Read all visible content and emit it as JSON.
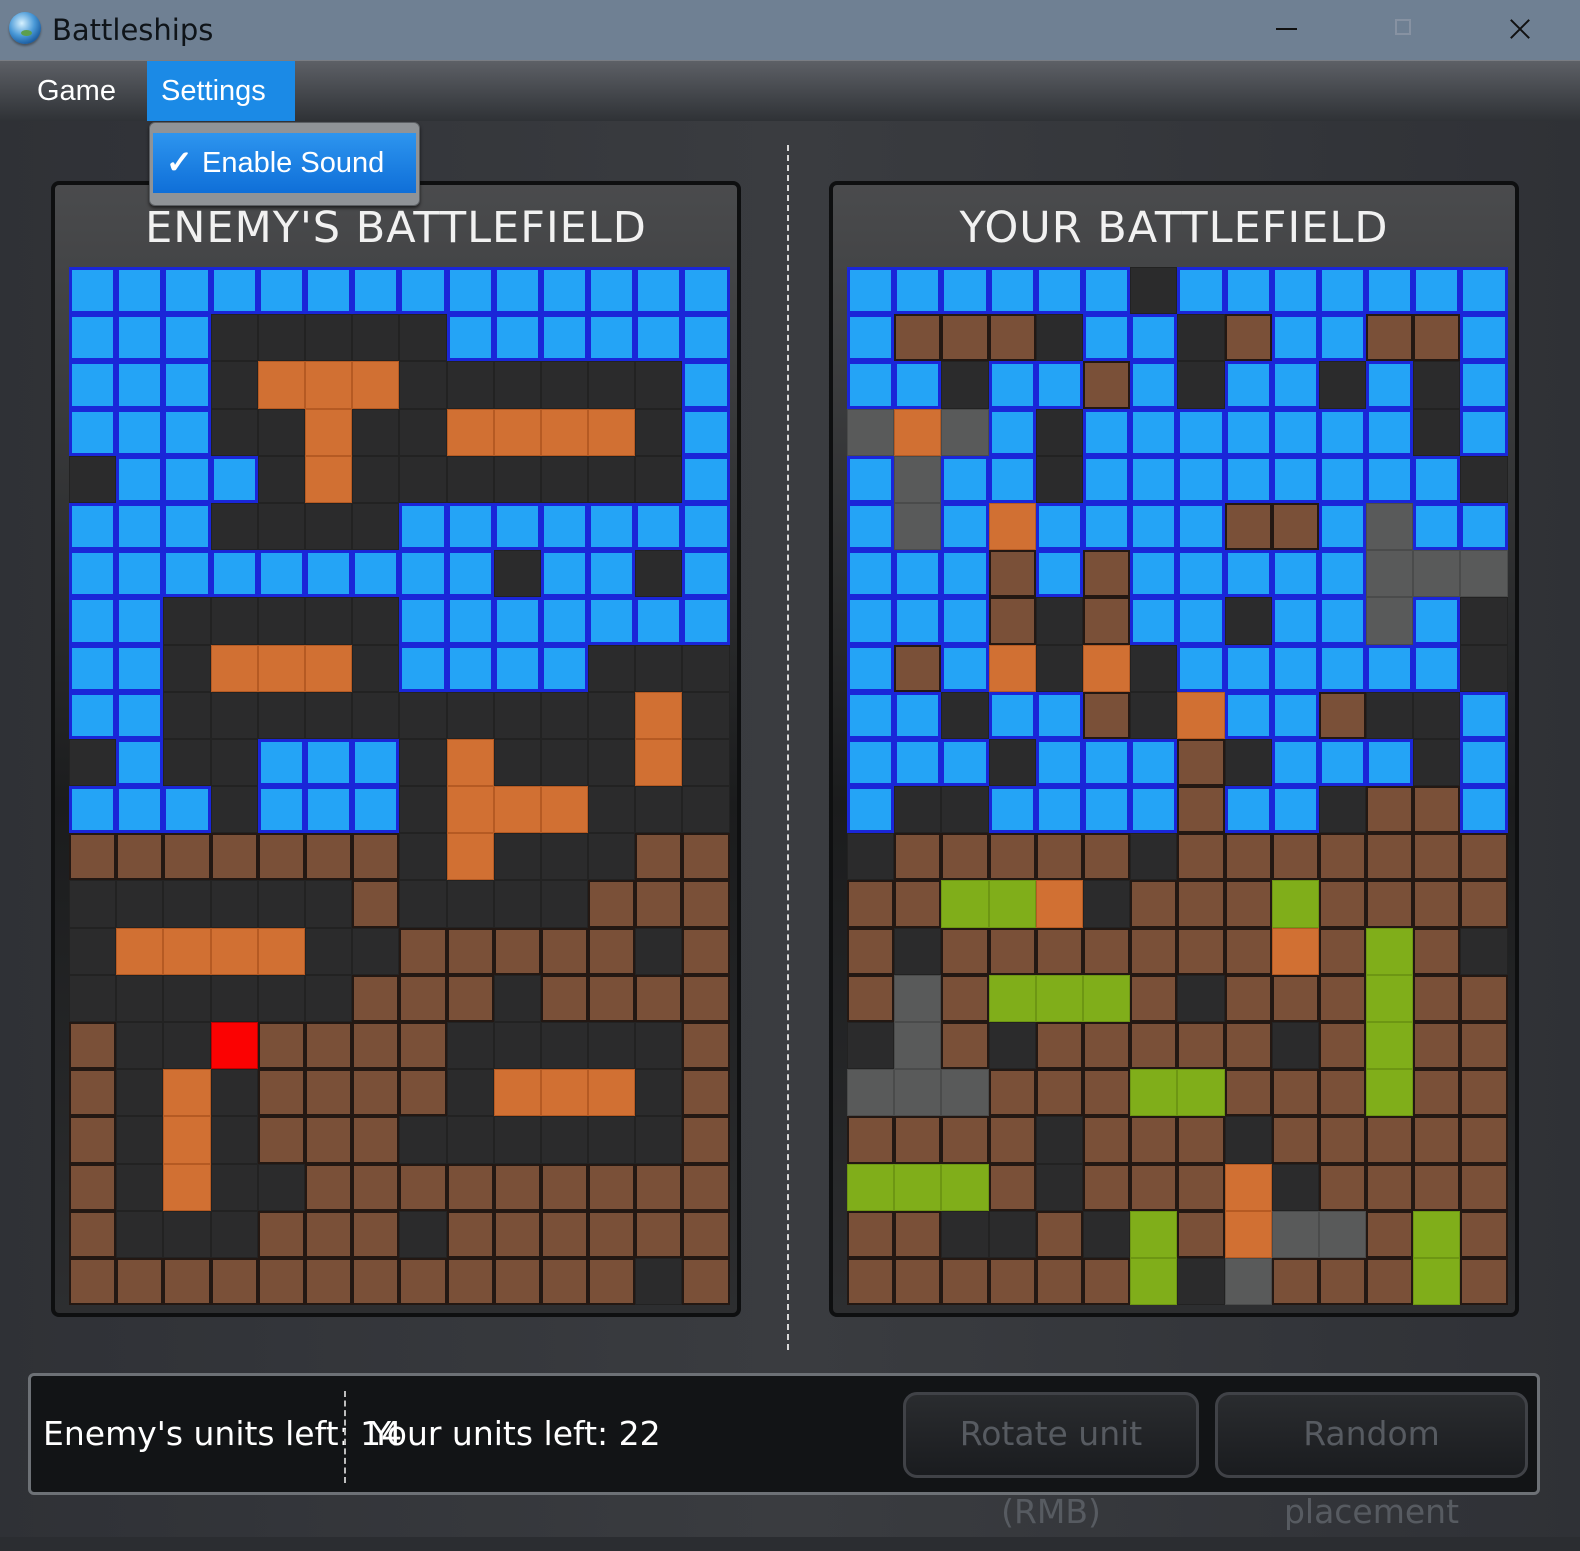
{
  "window": {
    "title": "Battleships"
  },
  "menu": {
    "game": "Game",
    "settings": "Settings",
    "dropdown": {
      "enable_sound": "Enable Sound",
      "checked": true
    }
  },
  "enemy": {
    "title": "ENEMY'S BATTLEFIELD",
    "grid": [
      "WWWWWWWWWWWWWW",
      "WWWDDDDDWWWWWW",
      "WWWDSSSDDDDDDW",
      "WWWDDSDDSSSSDW",
      "DWWWDSDDDDDDDW",
      "WWWDDDDWWWWWWW",
      "WWWWWWWWWDWWDW",
      "WWDDDDDWWWWWWW",
      "WWDSSSDWWWWDDD",
      "WWDDDDDDDDDDSD",
      "DWDDWWWDSDDDSD",
      "WWWDWWWDSSSDDD",
      "LLLLLLLDSDDDLL",
      "DDDDDDLDDDDLLL",
      "DSSSSDDLLLLLDL",
      "DDDDDDLLLDLLLL",
      "LDDHLLLLDDDDDL",
      "LDSDLLLLDSSSDL",
      "LDSDLLLDDDDDDL",
      "LDSDDLLLLLLLLL",
      "LDDDLLLDLLLLLL",
      "LLLLLLLLLLLLDL"
    ]
  },
  "player": {
    "title": "YOUR BATTLEFIELD",
    "grid": [
      "WWWWWWDWWWWWWW",
      "WLLLDWWDLWWLLW",
      "WWDWWLWDWWDWDW",
      "GSGWDWWWWWWWDW",
      "WGWWDWWWWWWWWD",
      "WGWSWWWWLLWGWW",
      "WWWLWLWWWWWGGG",
      "WWWLDLWWDWWGWD",
      "WLWSDSDWWWWWWD",
      "WWDWWLDSWWLDDW",
      "WWWDWWWLDWWWDW",
      "WDDWWWWLWWDLLW",
      "DLLLLLDLLLLLLL",
      "LLVVSDLLLVLLLL",
      "LDLLLLLLLSLVLD",
      "LGLVVVLDLLLVLL",
      "DGLDLLLLLDLVLL",
      "GGGLLLVVLLLVLL",
      "LLLLDLLLDLLLLL",
      "VVVLDLLLSDLLLL",
      "LLDDLDVLSGGLVL",
      "LLLLLLVDGLLLVL"
    ]
  },
  "legend": {
    "W": "water",
    "D": "dark",
    "S": "ship",
    "L": "land",
    "H": "hit",
    "G": "gray",
    "V": "green",
    "colors": {
      "water": "#24a4f6",
      "water_border": "#1a26d8",
      "ship": "#d17033",
      "land": "#7a5038",
      "hit": "#fb0202",
      "light_marker": "#bfcad2",
      "gray_marker": "#595a5a",
      "green_ship": "#80ae1a",
      "selection": "#1b8ae6"
    }
  },
  "status": {
    "enemy_units": "Enemy's units left: 14",
    "player_units": "Your units left: 22",
    "rotate_button": "Rotate unit (RMB)",
    "random_button": "Random placement"
  }
}
